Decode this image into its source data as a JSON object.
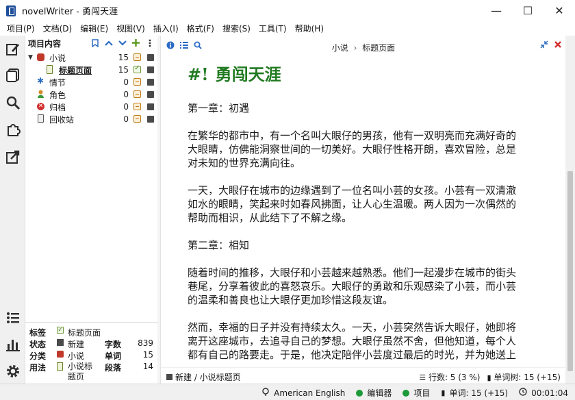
{
  "window": {
    "title": "novelWriter - 勇闯天涯",
    "controls": [
      "minimize",
      "maximize",
      "close"
    ]
  },
  "menu": [
    "项目(P)",
    "文档(D)",
    "编辑(E)",
    "视图(V)",
    "插入(I)",
    "格式(F)",
    "搜索(S)",
    "工具(T)",
    "帮助(H)"
  ],
  "rail": {
    "top": [
      "edit-icon",
      "outline-icon",
      "search-icon",
      "plugin-icon",
      "export-icon"
    ],
    "bottom": [
      "list-icon",
      "stats-icon",
      "settings-icon"
    ]
  },
  "tree": {
    "title": "项目内容",
    "tools": [
      "bookmark-icon",
      "move-up-icon",
      "move-down-icon",
      "add-icon",
      "more-icon"
    ],
    "items": [
      {
        "label": "小说",
        "count": "15",
        "level": 0,
        "expanded": true,
        "icon": "novel-icon",
        "status": "draft",
        "bold": false
      },
      {
        "label": "标题页面",
        "count": "15",
        "level": 1,
        "icon": "document-icon",
        "status": "ok",
        "bold": true
      },
      {
        "label": "情节",
        "count": "0",
        "level": 0,
        "icon": "plot-icon",
        "status": "draft",
        "bold": false
      },
      {
        "label": "角色",
        "count": "0",
        "level": 0,
        "icon": "character-icon",
        "status": "draft",
        "bold": false
      },
      {
        "label": "归档",
        "count": "0",
        "level": 0,
        "icon": "archive-icon",
        "status": "draft",
        "bold": false
      },
      {
        "label": "回收站",
        "count": "0",
        "level": 0,
        "icon": "trash-icon",
        "status": "draft",
        "bold": false
      }
    ]
  },
  "details": {
    "label_key": "标签",
    "label_value": "标题页面",
    "status_key": "状态",
    "status_value": "新建",
    "class_key": "分类",
    "class_value": "小说",
    "usage_key": "用法",
    "usage_value": "小说标题页",
    "chars_key": "字数",
    "chars_value": "839",
    "words_key": "单词",
    "words_value": "15",
    "paras_key": "段落",
    "paras_value": "14"
  },
  "editor": {
    "breadcrumb_root": "小说",
    "breadcrumb_sep": "›",
    "breadcrumb_doc": "标题页面",
    "title_hash": "#!",
    "title_text": "勇闯天涯",
    "paragraphs": [
      {
        "type": "chapter",
        "text": "第一章：初遇"
      },
      {
        "type": "p",
        "text": "在繁华的都市中，有一个名叫大眼仔的男孩，他有一双明亮而充满好奇的\n大眼睛，仿佛能洞察世间的一切美好。大眼仔性格开朗，喜欢冒险，总是\n对未知的世界充满向往。"
      },
      {
        "type": "p",
        "text": "一天，大眼仔在城市的边缘遇到了一位名叫小芸的女孩。小芸有一双清澈\n如水的眼睛，笑起来时如春风拂面，让人心生温暖。两人因为一次偶然的\n帮助而相识，从此结下了不解之缘。"
      },
      {
        "type": "chapter",
        "text": "第二章：相知"
      },
      {
        "type": "p",
        "text": "随着时间的推移，大眼仔和小芸越来越熟悉。他们一起漫步在城市的街头\n巷尾，分享着彼此的喜怒哀乐。大眼仔的勇敢和乐观感染了小芸，而小芸\n的温柔和善良也让大眼仔更加珍惜这段友谊。"
      },
      {
        "type": "p",
        "text": "然而，幸福的日子并没有持续太久。一天，小芸突然告诉大眼仔，她即将\n离开这座城市，去追寻自己的梦想。大眼仔虽然不舍，但他知道，每个人\n都有自己的路要走。于是，他决定陪伴小芸度过最后的时光，并为她送上"
      }
    ],
    "footer_status": "新建 / 小说标题页",
    "footer_lines": "行数: 5 (3 %)",
    "footer_words": "单词树: 15 (+15)"
  },
  "statusbar": {
    "language": "American English",
    "editor": "编辑器",
    "project": "项目",
    "words": "单词: 15 (+15)",
    "time": "00:01:04"
  },
  "colors": {
    "accent": "#2b6cc4",
    "title_green": "#217a21",
    "status_green": "#1c9a3a",
    "novel_red": "#c0392b"
  }
}
